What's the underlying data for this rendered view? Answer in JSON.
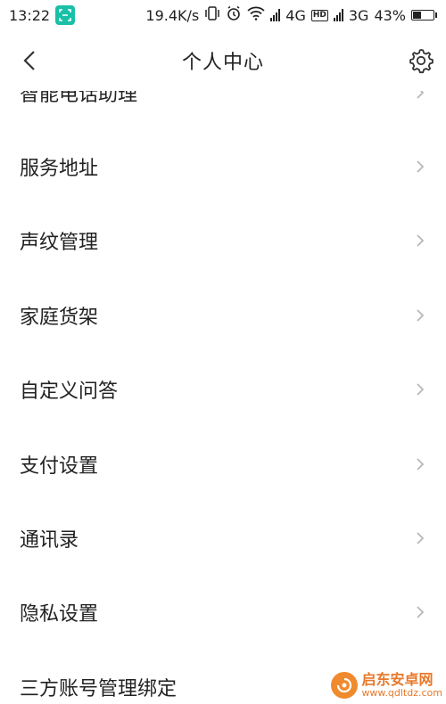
{
  "status_bar": {
    "time": "13:22",
    "net_speed": "19.4K/s",
    "network1": "4G",
    "network2": "3G",
    "battery_percent": "43%",
    "battery_level": 43
  },
  "header": {
    "title": "个人中心",
    "back_icon": "chevron-left-icon",
    "settings_icon": "gear-icon"
  },
  "menu": {
    "items": [
      {
        "label": "智能电话助理"
      },
      {
        "label": "服务地址"
      },
      {
        "label": "声纹管理"
      },
      {
        "label": "家庭货架"
      },
      {
        "label": "自定义问答"
      },
      {
        "label": "支付设置"
      },
      {
        "label": "通讯录"
      },
      {
        "label": "隐私设置"
      },
      {
        "label": "三方账号管理绑定"
      }
    ]
  },
  "watermark": {
    "name": "启东安卓网",
    "url": "www.qdltdz.com"
  },
  "colors": {
    "scan_badge": "#19c0a8",
    "text": "#222222",
    "chevron": "#b8b8b8",
    "watermark": "#e8782a"
  }
}
